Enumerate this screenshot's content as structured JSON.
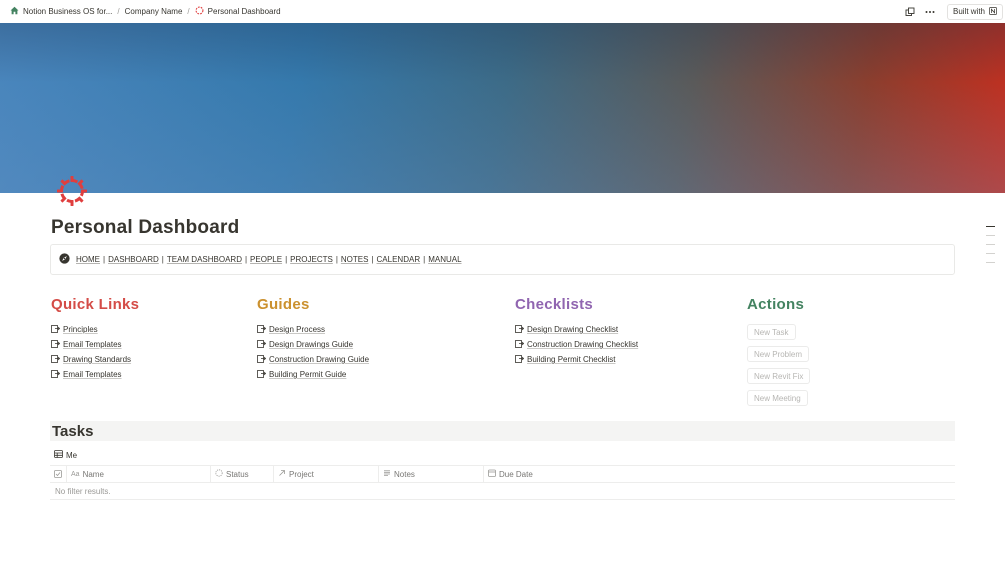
{
  "breadcrumb": {
    "items": [
      "Notion Business OS for...",
      "Company Name",
      "Personal Dashboard"
    ],
    "separator": "/"
  },
  "topbar": {
    "built_label": "Built with"
  },
  "page": {
    "title": "Personal Dashboard"
  },
  "nav": {
    "links": [
      "HOME",
      "DASHBOARD",
      "TEAM DASHBOARD",
      "PEOPLE",
      "PROJECTS",
      "NOTES",
      "CALENDAR",
      "MANUAL"
    ],
    "separator": "|"
  },
  "quick_links": {
    "title": "Quick Links",
    "items": [
      "Principles",
      "Email Templates",
      "Drawing Standards",
      "Email Templates"
    ]
  },
  "guides": {
    "title": "Guides",
    "items": [
      "Design Process",
      "Design Drawings Guide",
      "Construction Drawing Guide",
      "Building Permit Guide"
    ]
  },
  "checklists": {
    "title": "Checklists",
    "items": [
      "Design Drawing Checklist",
      "Construction Drawing Checklist",
      "Building Permit Checklist"
    ]
  },
  "actions": {
    "title": "Actions",
    "buttons": [
      "New Task",
      "New Problem",
      "New Revit Fix",
      "New Meeting"
    ]
  },
  "tasks": {
    "title": "Tasks",
    "view_tab": "Me",
    "columns": [
      "Name",
      "Status",
      "Project",
      "Notes",
      "Due Date"
    ],
    "empty_text": "No filter results."
  },
  "colors": {
    "quick_links": "#d44c47",
    "guides": "#cb912f",
    "checklists": "#9065b0",
    "actions": "#448361",
    "page_icon": "#e03e3e"
  }
}
